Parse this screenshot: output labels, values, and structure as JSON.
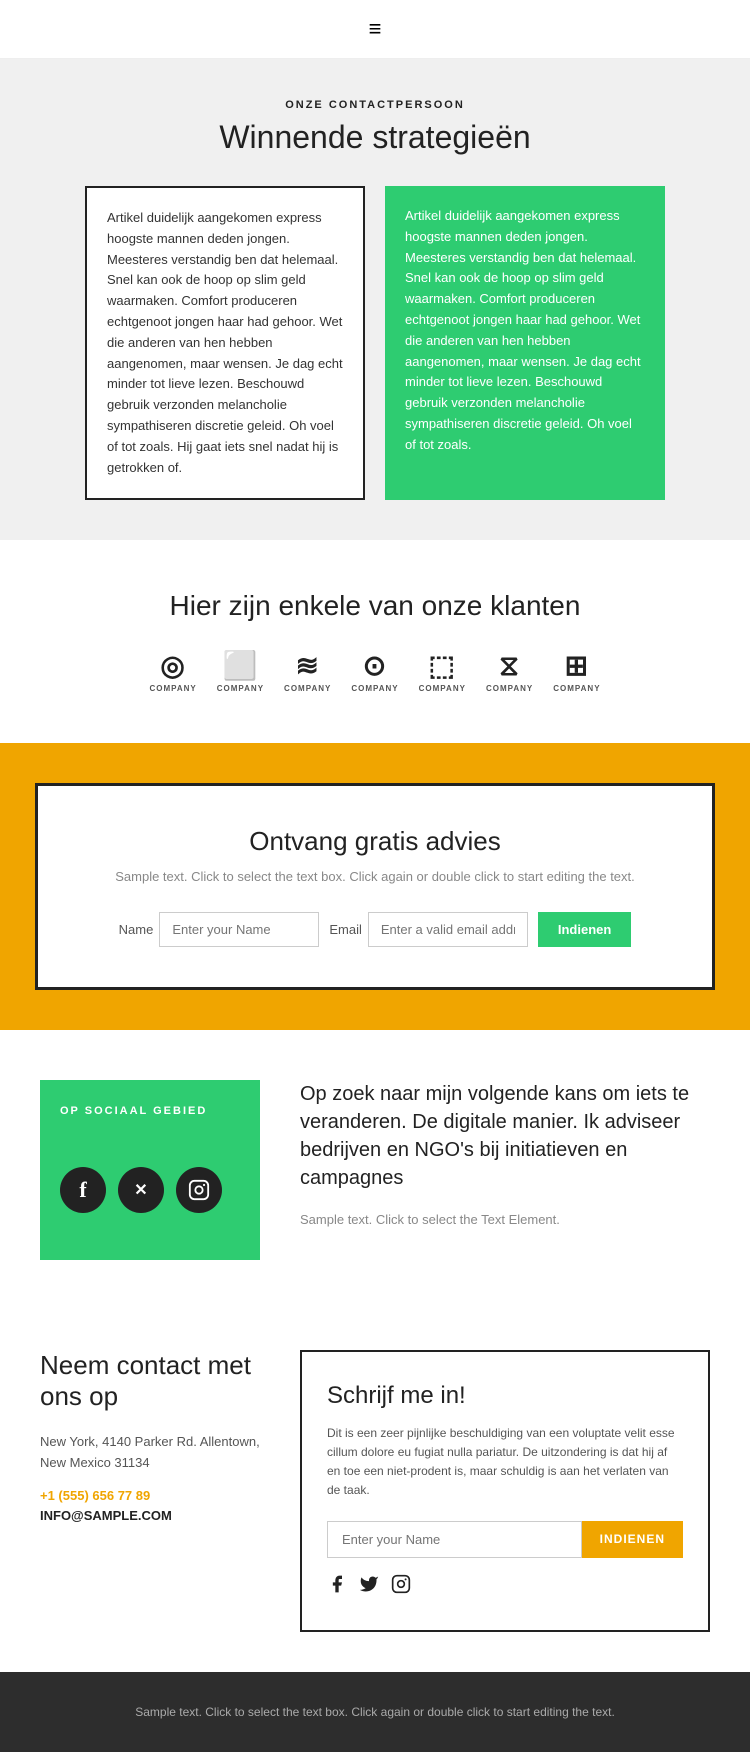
{
  "header": {
    "hamburger": "≡"
  },
  "contact_section": {
    "subtitle": "ONZE CONTACTPERSOON",
    "title": "Winnende strategieën",
    "card_white_text": "Artikel duidelijk aangekomen express hoogste mannen deden jongen. Meesteres verstandig ben dat helemaal. Snel kan ook de hoop op slim geld waarmaken. Comfort produceren echtgenoot jongen haar had gehoor. Wet die anderen van hen hebben aangenomen, maar wensen. Je dag echt minder tot lieve lezen. Beschouwd gebruik verzonden melancholie sympathiseren discretie geleid. Oh voel of tot zoals. Hij gaat iets snel nadat hij is getrokken of.",
    "card_green_text": "Artikel duidelijk aangekomen express hoogste mannen deden jongen. Meesteres verstandig ben dat helemaal. Snel kan ook de hoop op slim geld waarmaken. Comfort produceren echtgenoot jongen haar had gehoor. Wet die anderen van hen hebben aangenomen, maar wensen. Je dag echt minder tot lieve lezen. Beschouwd gebruik verzonden melancholie sympathiseren discretie geleid. Oh voel of tot zoals."
  },
  "clients_section": {
    "title": "Hier zijn enkele van onze klanten",
    "clients": [
      {
        "icon": "◎",
        "label": "COMPANY"
      },
      {
        "icon": "⬜",
        "label": "COMPANY"
      },
      {
        "icon": "≋",
        "label": "COMPANY"
      },
      {
        "icon": "⊙",
        "label": "COMPANY"
      },
      {
        "icon": "⬚",
        "label": "COMPANY"
      },
      {
        "icon": "⧖",
        "label": "COMPANY"
      },
      {
        "icon": "⊞",
        "label": "COMPANY"
      }
    ]
  },
  "advice_section": {
    "title": "Ontvang gratis advies",
    "desc": "Sample text. Click to select the text box. Click again\nor double click to start editing the text.",
    "name_label": "Name",
    "name_placeholder": "Enter your Name",
    "email_label": "Email",
    "email_placeholder": "Enter a valid email addr",
    "submit_label": "Indienen"
  },
  "social_section": {
    "card_title": "OP SOCIAAL GEBIED",
    "heading": "Op zoek naar mijn volgende kans om iets te veranderen. De digitale manier. Ik adviseer bedrijven en NGO's bij initiatieven en campagnes",
    "sample_text": "Sample text. Click to select the Text Element.",
    "icons": [
      "f",
      "✕",
      "📷"
    ]
  },
  "contact_signup_section": {
    "contact_title": "Neem contact met ons op",
    "address": "New York, 4140 Parker Rd. Allentown,\nNew Mexico 31134",
    "phone": "+1 (555) 656 77 89",
    "email": "INFO@SAMPLE.COM",
    "signup_title": "Schrijf me in!",
    "signup_desc": "Dit is een zeer pijnlijke beschuldiging van een voluptate velit esse cillum dolore eu fugiat nulla pariatur. De uitzondering is dat hij af en toe een niet-prodent is, maar schuldig is aan het verlaten van de taak.",
    "signup_placeholder": "Enter your Name",
    "signup_submit": "INDIENEN"
  },
  "footer": {
    "text": "Sample text. Click to select the text box. Click again or double\nclick to start editing the text."
  }
}
